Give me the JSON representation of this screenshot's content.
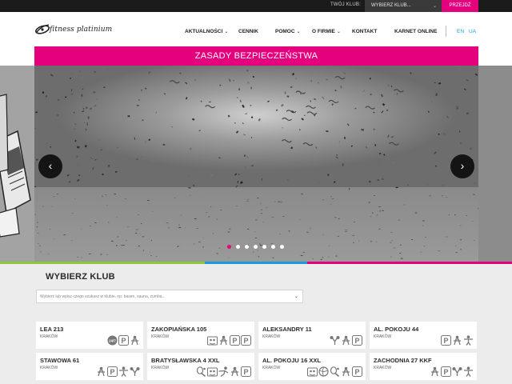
{
  "topbar": {
    "club_label": "TWÓJ KLUB:",
    "club_select": "WYBIERZ KLUB...",
    "go_button": "PRZEJDŹ"
  },
  "header": {
    "logo_text": "fitness platinium",
    "nav": [
      {
        "label": "AKTUALNOŚCI",
        "has_dropdown": true
      },
      {
        "label": "CENNIK",
        "has_dropdown": false
      },
      {
        "label": "POMOC",
        "has_dropdown": true
      },
      {
        "label": "O FIRMIE",
        "has_dropdown": true
      },
      {
        "label": "KONTAKT",
        "has_dropdown": false
      },
      {
        "label": "KARNET ONLINE",
        "has_dropdown": false
      }
    ],
    "languages": [
      "EN",
      "UA"
    ]
  },
  "banner": {
    "text": "ZASADY BEZPIECZEŃSTWA"
  },
  "slider": {
    "prev_icon": "chevron-left-icon",
    "next_icon": "chevron-right-icon",
    "slide_count": 7,
    "active_slide": 1
  },
  "clubs": {
    "title": "WYBIERZ KLUB",
    "search_placeholder": "Wybierz lub wpisz czego szukasz w klubie, np. basen, sauna, zumba...",
    "cards": [
      {
        "name": "LEA 213",
        "city": "KRAKÓW",
        "icons": [
          "24-7-icon",
          "parking-icon",
          "sauna-icon"
        ]
      },
      {
        "name": "ZAKOPIAŃSKA 105",
        "city": "KRAKÓW",
        "icons": [
          "kids-room-icon",
          "sauna-icon",
          "parking-icon",
          "parking-icon"
        ]
      },
      {
        "name": "ALEKSANDRY 11",
        "city": "KRAKÓW",
        "icons": [
          "boxing-icon",
          "sauna-icon",
          "parking-icon"
        ]
      },
      {
        "name": "AL. POKOJU 44",
        "city": "KRAKÓW",
        "icons": [
          "parking-icon",
          "sauna-icon",
          "trainer-icon"
        ]
      },
      {
        "name": "STAWOWA 61",
        "city": "KRAKÓW",
        "icons": [
          "sauna-icon",
          "parking-icon",
          "trainer-icon",
          "boxing-icon"
        ]
      },
      {
        "name": "BRATYSŁAWSKA 4 XXL",
        "city": "KRAKÓW",
        "icons": [
          "squash-icon",
          "kids-room-icon",
          "martial-arts-icon",
          "sauna-icon",
          "parking-icon"
        ]
      },
      {
        "name": "AL. POKOJU 16 XXL",
        "city": "KRAKÓW",
        "icons": [
          "kids-room-icon",
          "ball-icon",
          "squash-icon",
          "sauna-icon",
          "parking-icon"
        ]
      },
      {
        "name": "ZACHODNIA 27 KKF",
        "city": "KRAKÓW",
        "icons": [
          "sauna-icon",
          "parking-icon",
          "boxing-icon",
          "trainer-icon"
        ]
      }
    ]
  },
  "colors": {
    "accent": "#e5007e",
    "link": "#1a9bd7",
    "stripe_green": "#8dc63f",
    "stripe_blue": "#1a9bd7"
  }
}
